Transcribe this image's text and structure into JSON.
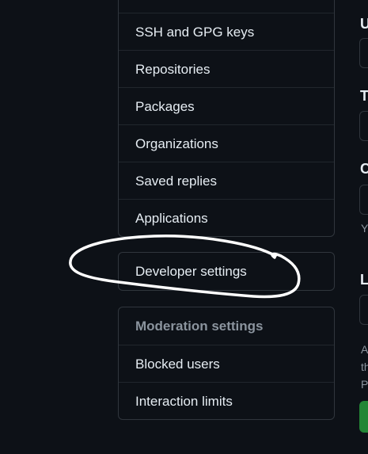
{
  "menu_group_1": {
    "items": [
      "SSH and GPG keys",
      "Repositories",
      "Packages",
      "Organizations",
      "Saved replies",
      "Applications"
    ]
  },
  "menu_group_2": {
    "items": [
      "Developer settings"
    ]
  },
  "menu_group_3": {
    "heading": "Moderation settings",
    "items": [
      "Blocked users",
      "Interaction limits"
    ]
  },
  "right_panel": {
    "labels": [
      "U",
      "T",
      "C",
      "L"
    ],
    "notes": [
      "Y",
      "A",
      "th",
      "P"
    ]
  },
  "colors": {
    "background": "#0d1117",
    "border": "#30363d",
    "text": "#e6edf3",
    "muted": "#8b949e",
    "green": "#238636"
  }
}
